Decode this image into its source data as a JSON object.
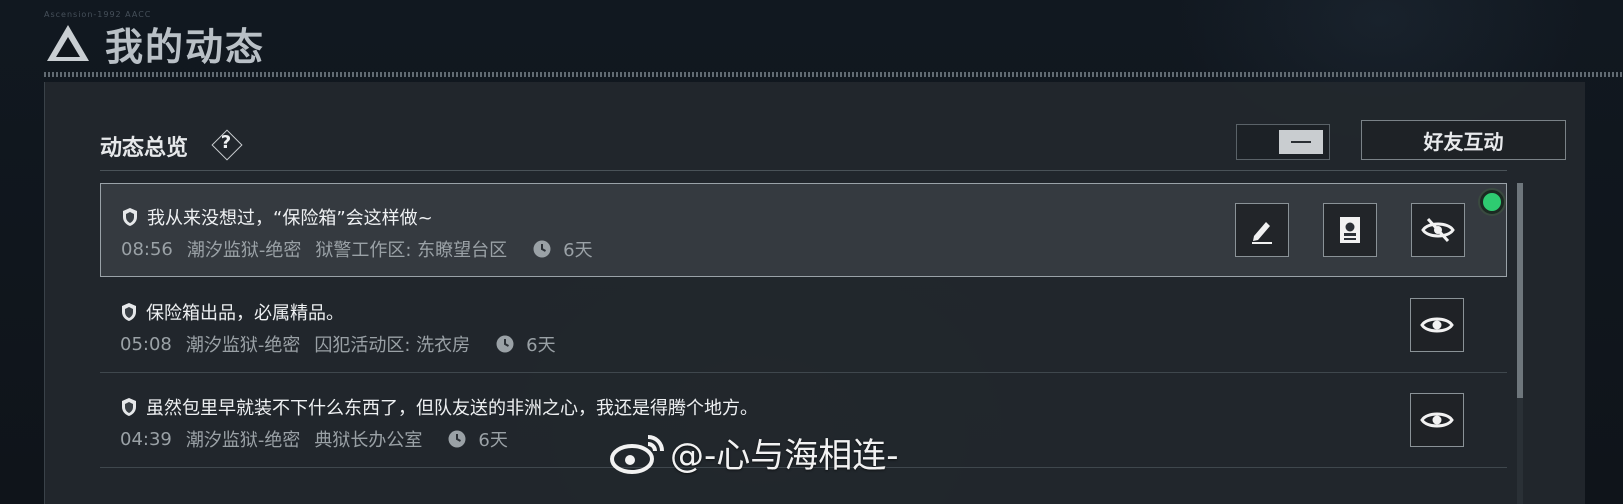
{
  "header": {
    "title": "我的动态",
    "small_text": "Ascension-1992 AACC"
  },
  "overview": {
    "title": "动态总览",
    "help_symbol": "?",
    "friend_button_label": "好友互动"
  },
  "feed": [
    {
      "message": "我从来没想过，“保险箱”会这样做~",
      "time": "08:56",
      "map": "潮汐监狱-绝密",
      "location": "狱警工作区: 东瞭望台区",
      "age": "6天",
      "selected": true,
      "actions": [
        "edit-icon",
        "id-card-icon",
        "eye-off-icon"
      ]
    },
    {
      "message": "保险箱出品，必属精品。",
      "time": "05:08",
      "map": "潮汐监狱-绝密",
      "location": "囚犯活动区: 洗衣房",
      "age": "6天",
      "selected": false,
      "actions": [
        "eye-icon"
      ]
    },
    {
      "message": "虽然包里早就装不下什么东西了，但队友送的非洲之心，我还是得腾个地方。",
      "time": "04:39",
      "map": "潮汐监狱-绝密",
      "location": "典狱长办公室",
      "age": "6天",
      "selected": false,
      "actions": [
        "eye-icon"
      ]
    }
  ],
  "watermark": {
    "text": "@-心与海相连-"
  },
  "colors": {
    "status_online": "#2ecc71",
    "background": "#10151b",
    "panel": "#23282e"
  }
}
